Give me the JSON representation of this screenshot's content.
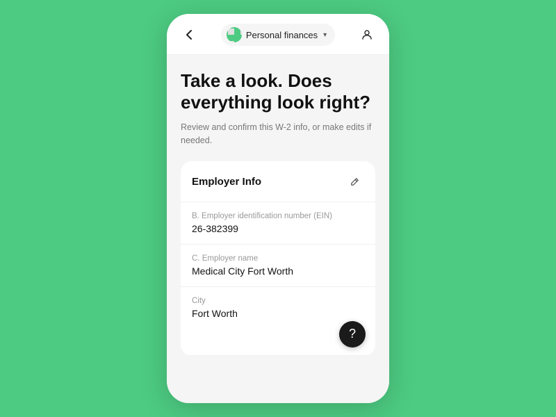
{
  "topBar": {
    "appTitle": "Personal finances",
    "chevron": "▾"
  },
  "content": {
    "headline": "Take a look. Does everything look right?",
    "subtext": "Review and confirm this W-2 info, or make edits if needed.",
    "card": {
      "title": "Employer Info",
      "fields": [
        {
          "label": "B. Employer identification number (EIN)",
          "value": "26-382399"
        },
        {
          "label": "C. Employer name",
          "value": "Medical City Fort Worth"
        },
        {
          "label": "City",
          "value": "Fort Worth"
        }
      ]
    }
  },
  "icons": {
    "back": "‹",
    "edit": "✎",
    "help": "?"
  }
}
